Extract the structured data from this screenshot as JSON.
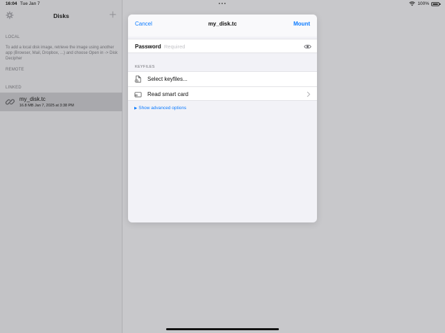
{
  "status_bar": {
    "time": "16:04",
    "date": "Tue Jan 7",
    "battery": "100%"
  },
  "sidebar": {
    "title": "Disks",
    "sections": {
      "local": "LOCAL",
      "local_help": "To add a local disk image, retrieve the image using another app (Browser, Mail, Dropbox, ...) and choose Open in -> Disk Decipher",
      "remote": "REMOTE",
      "linked": "LINKED"
    },
    "disk": {
      "name": "my_disk.tc",
      "meta": "16.8 MB  Jan 7, 2025 at 3:38 PM"
    }
  },
  "modal": {
    "title": "my_disk.tc",
    "cancel": "Cancel",
    "mount": "Mount",
    "password_label": "Password",
    "password_placeholder": "Required",
    "password_value": "",
    "keyfiles_header": "KEYFILES",
    "rows": [
      {
        "label": "Select keyfiles...",
        "icon": "document-add-icon"
      },
      {
        "label": "Read smart card",
        "icon": "smart-card-icon"
      }
    ],
    "advanced_link": "Show advanced options"
  },
  "colors": {
    "accent": "#0a7aff",
    "sidebar_bg": "#c3c3c6",
    "selected_row": "#a9a9ad",
    "modal_bg": "#f2f2f7",
    "dimmed_bg": "#c8c8cb"
  }
}
